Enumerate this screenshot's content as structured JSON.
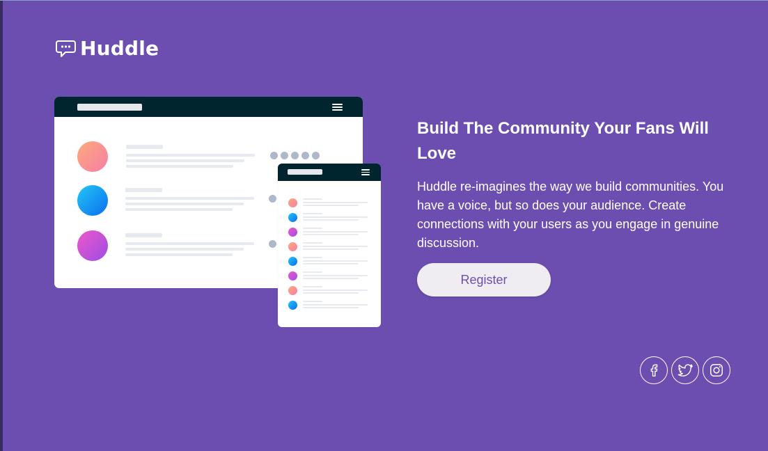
{
  "brand": {
    "name": "Huddle",
    "logo_icon": "chat-bubble-icon"
  },
  "hero": {
    "heading": "Build The Community Your Fans Will Love",
    "description": "Huddle re-imagines the way we build communities. You have a voice, but so does your audience. Create connections with your users as you engage in genuine discussion.",
    "register_label": "Register"
  },
  "illustration": {
    "desktop_avatar_colors": [
      "peach",
      "blue",
      "purple"
    ],
    "mobile_avatar_colors": [
      "peach",
      "blue",
      "purple",
      "peach",
      "blue",
      "purple",
      "peach",
      "blue"
    ]
  },
  "social": {
    "items": [
      {
        "name": "facebook",
        "icon": "facebook-icon"
      },
      {
        "name": "twitter",
        "icon": "twitter-icon"
      },
      {
        "name": "instagram",
        "icon": "instagram-icon"
      }
    ]
  },
  "colors": {
    "background": "#6b4eaf",
    "button_bg": "#efedf1",
    "button_text": "#6b4eaf",
    "mockup_bar": "#00252e"
  }
}
